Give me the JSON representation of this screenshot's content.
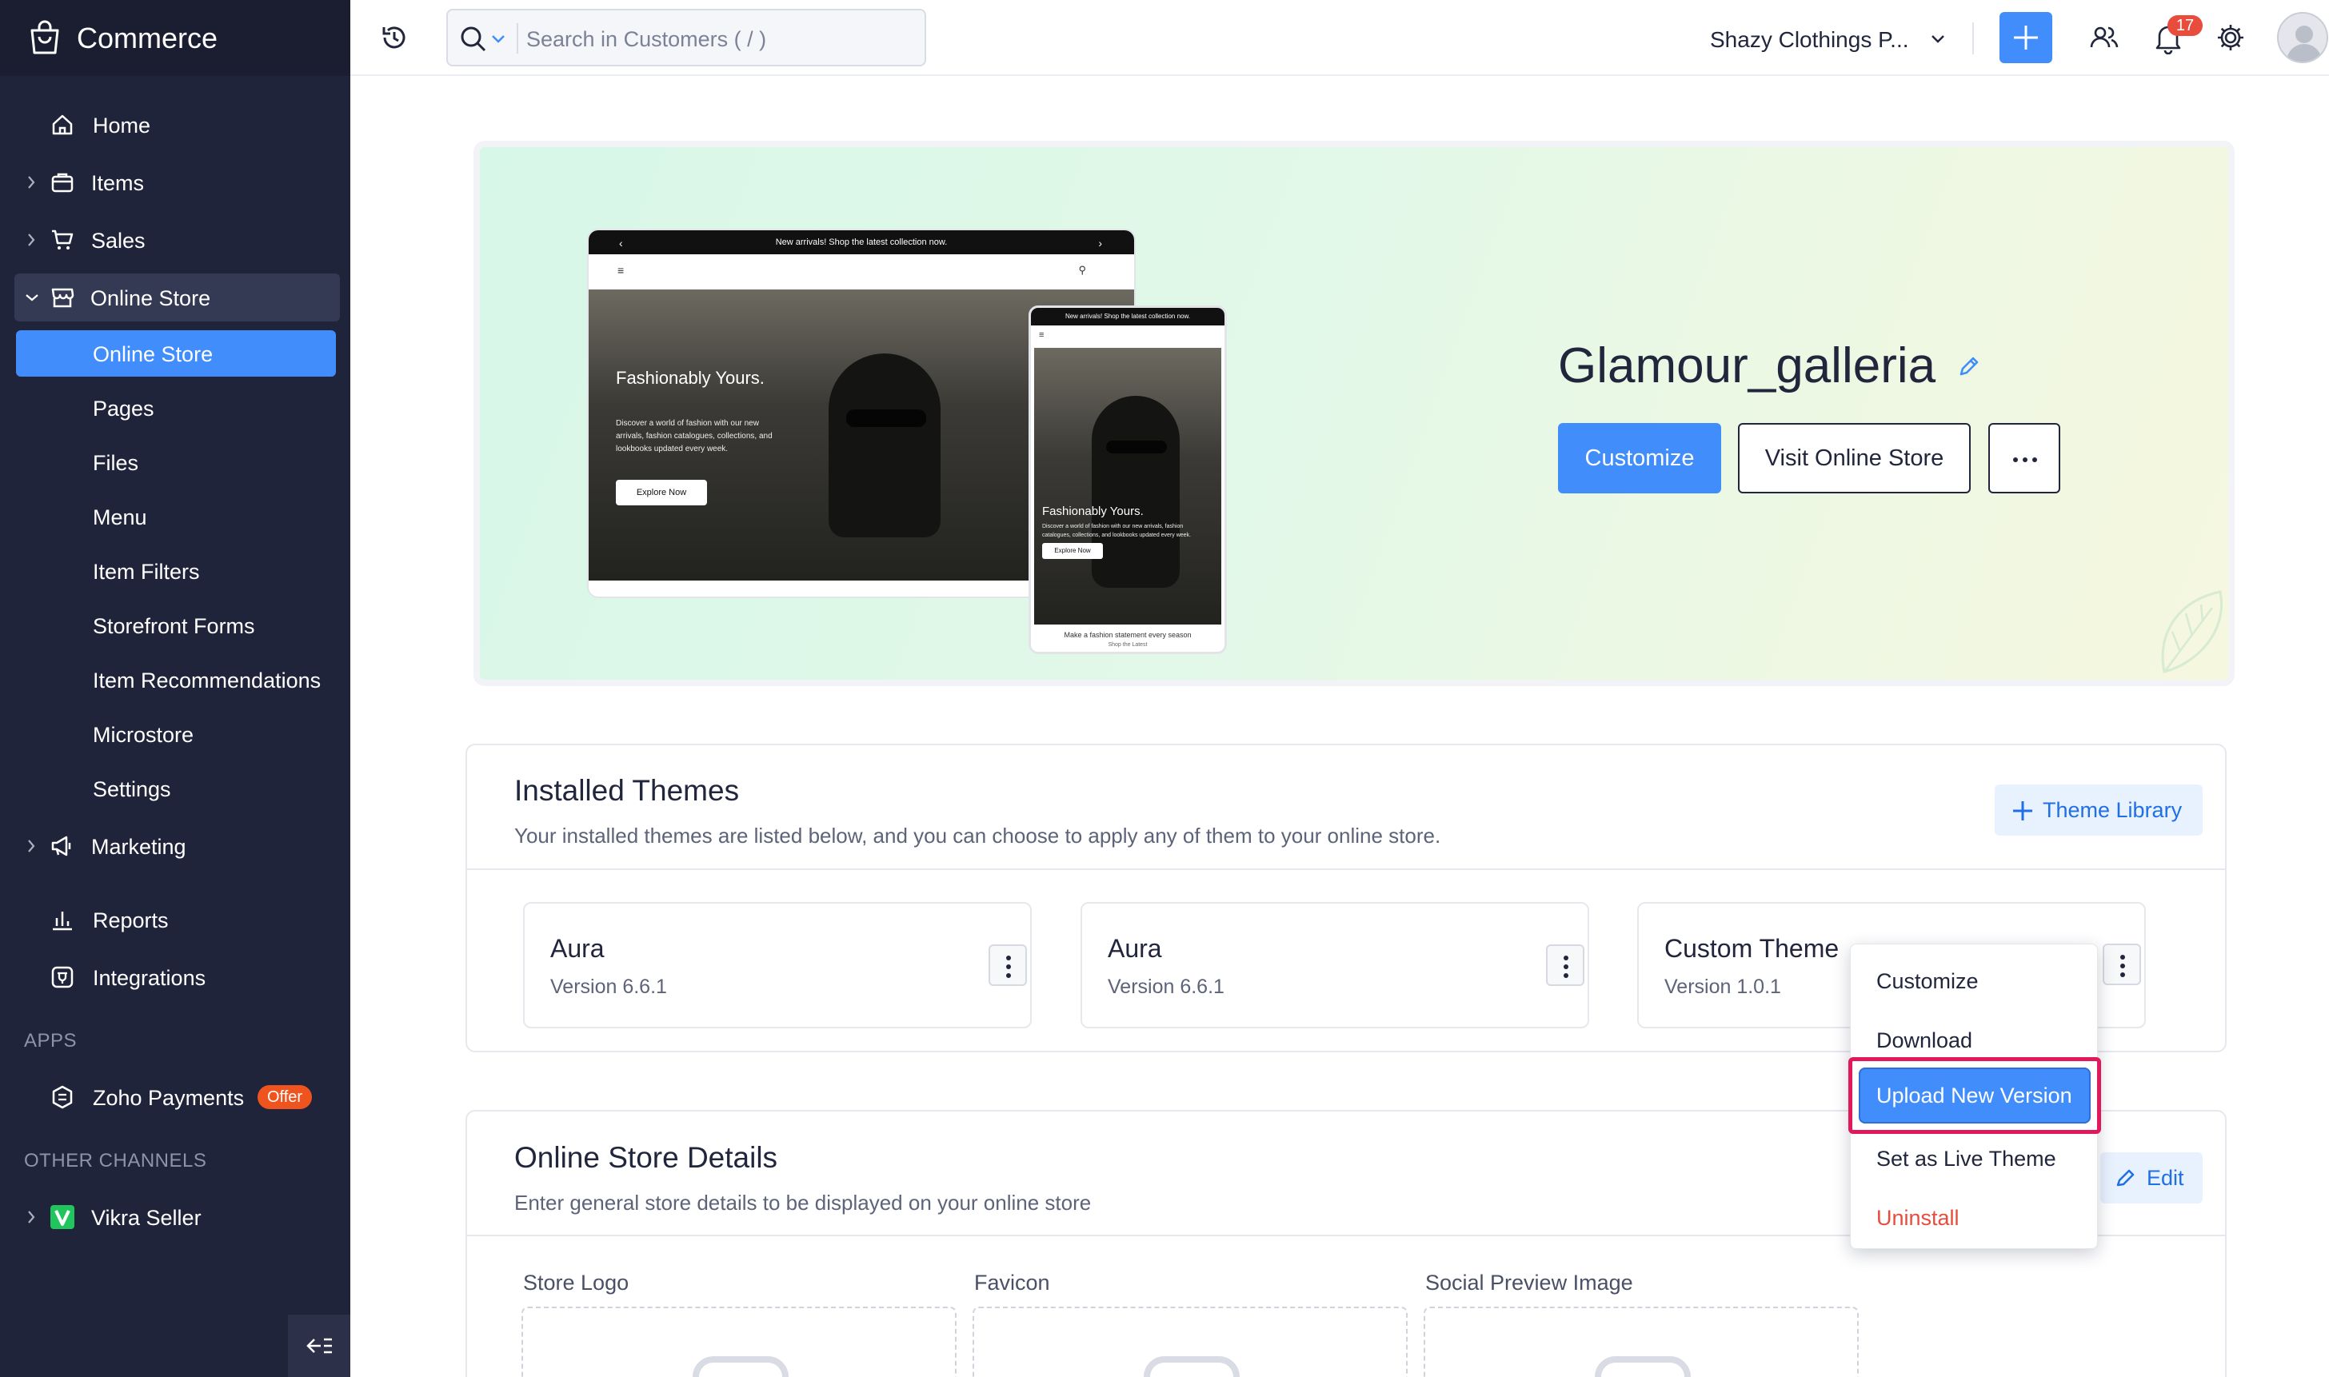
{
  "app": {
    "title": "Commerce"
  },
  "sidebar": {
    "items": [
      {
        "label": "Home"
      },
      {
        "label": "Items"
      },
      {
        "label": "Sales"
      },
      {
        "label": "Online Store"
      },
      {
        "label": "Marketing"
      },
      {
        "label": "Reports"
      },
      {
        "label": "Integrations"
      }
    ],
    "online_store_sub": [
      {
        "label": "Online Store"
      },
      {
        "label": "Pages"
      },
      {
        "label": "Files"
      },
      {
        "label": "Menu"
      },
      {
        "label": "Item Filters"
      },
      {
        "label": "Storefront Forms"
      },
      {
        "label": "Item Recommendations"
      },
      {
        "label": "Microstore"
      },
      {
        "label": "Settings"
      }
    ],
    "apps_heading": "APPS",
    "apps": [
      {
        "label": "Zoho Payments",
        "badge": "Offer"
      }
    ],
    "other_heading": "OTHER CHANNELS",
    "other": [
      {
        "label": "Vikra Seller"
      }
    ]
  },
  "header": {
    "search_placeholder": "Search in Customers ( / )",
    "org_name": "Shazy Clothings P...",
    "notification_count": "17"
  },
  "hero": {
    "store_name": "Glamour_galleria",
    "customize_label": "Customize",
    "visit_label": "Visit Online Store",
    "mock": {
      "banner": "New arrivals! Shop the latest collection now.",
      "headline": "Fashionably Yours.",
      "desc": "Discover a world of fashion with our new arrivals, fashion catalogues, collections, and lookbooks updated every week.",
      "cta": "Explore Now",
      "footer": "Make a fashion statement every season",
      "footer_link": "Shop the Latest"
    }
  },
  "installed_themes": {
    "title": "Installed Themes",
    "description": "Your installed themes are listed below, and you can choose to apply any of them to your online store.",
    "library_label": "Theme Library",
    "themes": [
      {
        "name": "Aura",
        "version": "Version 6.6.1"
      },
      {
        "name": "Aura",
        "version": "Version 6.6.1"
      },
      {
        "name": "Custom Theme",
        "version": "Version 1.0.1"
      }
    ]
  },
  "theme_menu": {
    "items": [
      "Customize",
      "Download",
      "Upload New Version",
      "Set as Live Theme",
      "Uninstall"
    ],
    "colors": {
      "danger": "#e74c3c",
      "highlight": "#408dfb",
      "outline": "#e0195a"
    }
  },
  "store_details": {
    "title": "Online Store Details",
    "description": "Enter general store details to be displayed on your online store",
    "edit_label": "Edit",
    "fields": [
      "Store Logo",
      "Favicon",
      "Social Preview Image"
    ]
  },
  "colors": {
    "sidebar": "#20243a",
    "accent": "#408dfb",
    "active_nav": "#408dfb"
  }
}
